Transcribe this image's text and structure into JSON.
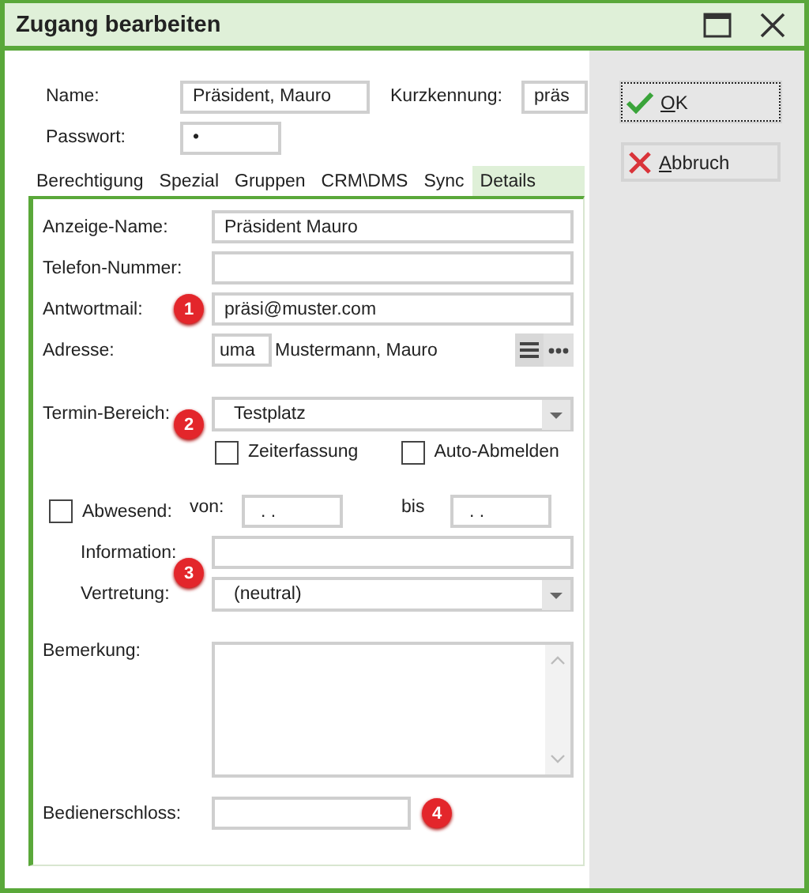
{
  "window": {
    "title": "Zugang bearbeiten"
  },
  "header": {
    "name_label": "Name:",
    "name_value": "Präsident, Mauro",
    "short_label": "Kurzkennung:",
    "short_value": "präs",
    "password_label": "Passwort:",
    "password_value": "•"
  },
  "tabs": [
    {
      "label": "Berechtigung",
      "selected": false
    },
    {
      "label": "Spezial",
      "selected": false
    },
    {
      "label": "Gruppen",
      "selected": false
    },
    {
      "label": "CRM\\DMS",
      "selected": false
    },
    {
      "label": "Sync",
      "selected": false
    },
    {
      "label": "Details",
      "selected": true
    }
  ],
  "details": {
    "display_name": {
      "label": "Anzeige-Name:",
      "value": "Präsident Mauro"
    },
    "phone": {
      "label": "Telefon-Nummer:"
    },
    "reply_mail": {
      "label": "Antwortmail:",
      "value": "präsi@muster.com",
      "marker": "1"
    },
    "address": {
      "label": "Adresse:",
      "code": "uma",
      "name": "Mustermann, Mauro"
    },
    "calendar": {
      "label": "Termin-Bereich:",
      "value": "Testplatz",
      "marker": "2"
    },
    "options": [
      {
        "label": "Zeiterfassung",
        "checked": false
      },
      {
        "label": "Auto-Abmelden",
        "checked": false
      }
    ],
    "absent": {
      "label": "Abwesend:",
      "checked": false,
      "from_label": "von:",
      "from_value": ". .",
      "to_label": "bis",
      "to_value": ". ."
    },
    "information": {
      "label": "Information:"
    },
    "deputy": {
      "label": "Vertretung:",
      "value": "(neutral)",
      "marker": "3"
    },
    "remark": {
      "label": "Bemerkung:"
    },
    "operator_lock": {
      "label": "Bedienerschloss:",
      "marker": "4"
    }
  },
  "buttons": [
    {
      "kind": "ok",
      "label": "OK",
      "focused": true
    },
    {
      "kind": "cancel",
      "label": "Abbruch",
      "focused": false
    }
  ]
}
